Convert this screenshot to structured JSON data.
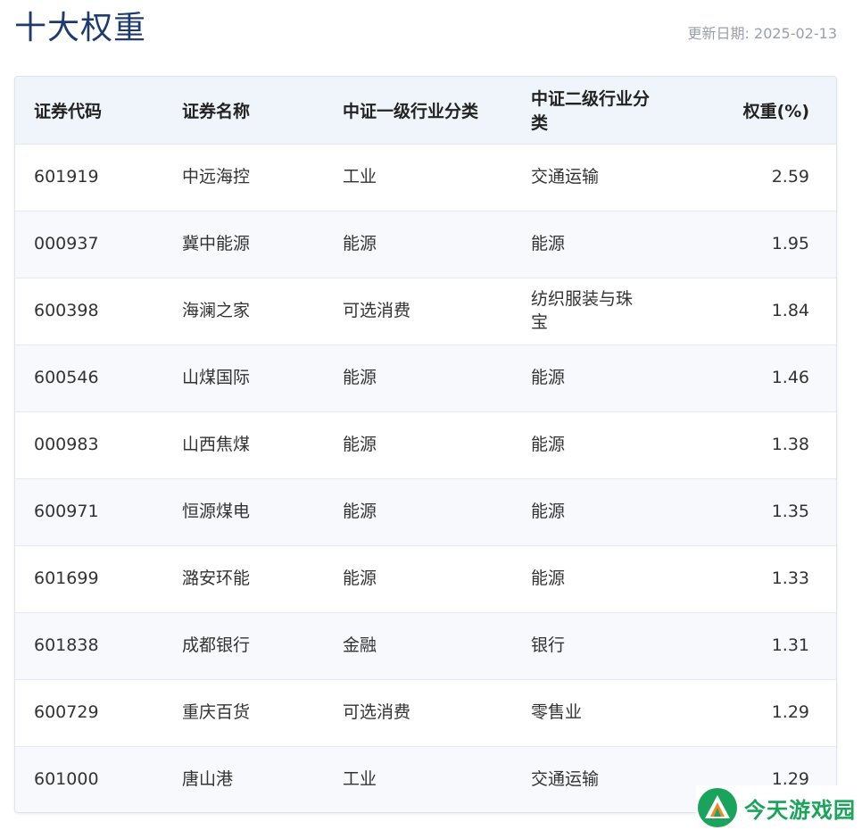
{
  "header": {
    "title": "十大权重",
    "update_date": "更新日期: 2025-02-13"
  },
  "table": {
    "columns": [
      "证券代码",
      "证券名称",
      "中证一级行业分类",
      "中证二级行业分类",
      "权重(%)"
    ],
    "rows": [
      [
        "601919",
        "中远海控",
        "工业",
        "交通运输",
        "2.59"
      ],
      [
        "000937",
        "冀中能源",
        "能源",
        "能源",
        "1.95"
      ],
      [
        "600398",
        "海澜之家",
        "可选消费",
        "纺织服装与珠宝",
        "1.84"
      ],
      [
        "600546",
        "山煤国际",
        "能源",
        "能源",
        "1.46"
      ],
      [
        "000983",
        "山西焦煤",
        "能源",
        "能源",
        "1.38"
      ],
      [
        "600971",
        "恒源煤电",
        "能源",
        "能源",
        "1.35"
      ],
      [
        "601699",
        "潞安环能",
        "能源",
        "能源",
        "1.33"
      ],
      [
        "601838",
        "成都银行",
        "金融",
        "银行",
        "1.31"
      ],
      [
        "600729",
        "重庆百货",
        "可选消费",
        "零售业",
        "1.29"
      ],
      [
        "601000",
        "唐山港",
        "工业",
        "交通运输",
        "1.29"
      ]
    ]
  },
  "watermark": {
    "text": "今天游戏园",
    "icon": "leaf-triangle-logo-icon",
    "color": "#1aa35a"
  }
}
